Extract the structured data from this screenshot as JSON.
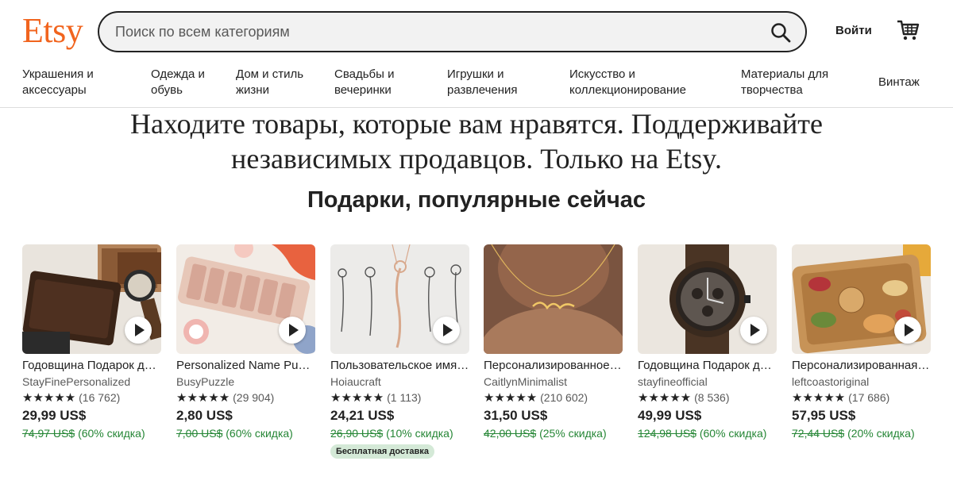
{
  "header": {
    "logo": "Etsy",
    "search_placeholder": "Поиск по всем категориям",
    "signin_label": "Войти"
  },
  "categories": [
    {
      "label": "Украшения и аксессуары"
    },
    {
      "label": "Одежда и обувь"
    },
    {
      "label": "Дом и стиль жизни"
    },
    {
      "label": "Свадьбы и вечеринки"
    },
    {
      "label": "Игрушки и развлечения"
    },
    {
      "label": "Искусство и коллекционирование"
    },
    {
      "label": "Материалы для творчества"
    },
    {
      "label": "Винтаж"
    }
  ],
  "hero": {
    "line1": "Находите товары, которые вам нравятся. Поддерживайте",
    "line2": "независимых продавцов. Только на Etsy."
  },
  "section_title": "Подарки, популярные сейчас",
  "products": [
    {
      "title": "Годовщина Подарок для мужчин",
      "shop": "StayFinePersonalized",
      "stars": "★★★★★",
      "reviews": "(16 762)",
      "price": "29,99 US$",
      "old_price": "74,97 US$",
      "discount": "(60% скидка)"
    },
    {
      "title": "Personalized Name Puzzle",
      "shop": "BusyPuzzle",
      "stars": "★★★★★",
      "reviews": "(29 904)",
      "price": "2,80 US$",
      "old_price": "7,00 US$",
      "discount": "(60% скидка)"
    },
    {
      "title": "Пользовательское имя ожерелье",
      "shop": "Hoiaucraft",
      "stars": "★★★★★",
      "reviews": "(1 113)",
      "price": "24,21 US$",
      "old_price": "26,90 US$",
      "discount": "(10% скидка)",
      "badge": "Бесплатная доставка"
    },
    {
      "title": "Персонализированное ожерелье",
      "shop": "CaitlynMinimalist",
      "stars": "★★★★★",
      "reviews": "(210 602)",
      "price": "31,50 US$",
      "old_price": "42,00 US$",
      "discount": "(25% скидка)"
    },
    {
      "title": "Годовщина Подарок для него",
      "shop": "stayfineofficial",
      "stars": "★★★★★",
      "reviews": "(8 536)",
      "price": "49,99 US$",
      "old_price": "124,98 US$",
      "discount": "(60% скидка)"
    },
    {
      "title": "Персонализированная доска",
      "shop": "leftcoastoriginal",
      "stars": "★★★★★",
      "reviews": "(17 686)",
      "price": "57,95 US$",
      "old_price": "72,44 US$",
      "discount": "(20% скидка)"
    }
  ],
  "colors": {
    "brand": "#f1641e",
    "discount": "#258635",
    "badge_bg": "#d4e9d7"
  }
}
